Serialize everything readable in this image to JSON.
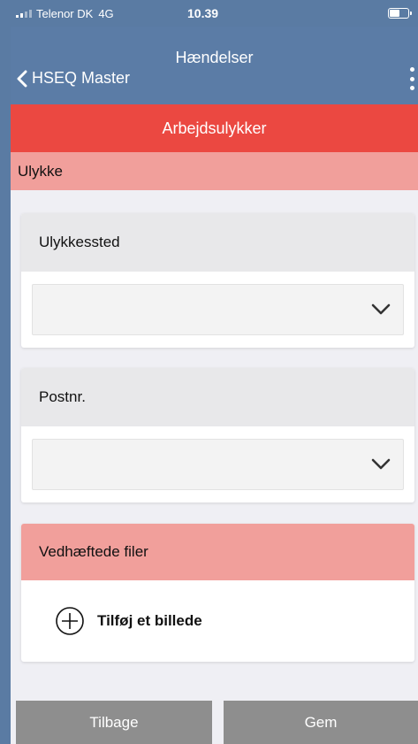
{
  "status_bar": {
    "carrier": "Telenor DK",
    "network": "4G",
    "time": "10.39",
    "battery_level": 0.55
  },
  "nav": {
    "title": "Hændelser",
    "back_label": "HSEQ Master",
    "back_icon": "chevron-left-icon",
    "more_icon": "more-vertical-icon"
  },
  "section": {
    "title": "Arbejdsulykker",
    "subtitle": "Ulykke"
  },
  "fields": [
    {
      "label": "Ulykkessted",
      "value": ""
    },
    {
      "label": "Postnr.",
      "value": ""
    }
  ],
  "attachments": {
    "title": "Vedhæftede filer",
    "add_label": "Tilføj et billede",
    "add_icon": "plus-circle-icon"
  },
  "footer": {
    "back_label": "Tilbage",
    "save_label": "Gem"
  },
  "colors": {
    "nav_bg": "#5b7ca6",
    "section_red": "#eb4841",
    "section_pink": "#f19f9b",
    "button_gray": "#8e8e8e",
    "page_bg": "#efeff4"
  }
}
